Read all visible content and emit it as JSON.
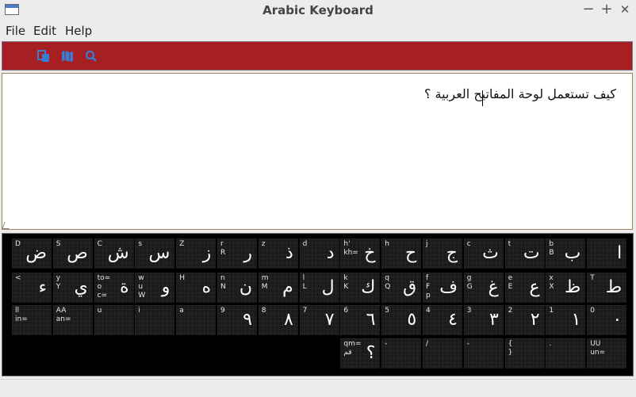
{
  "window": {
    "title": "Arabic Keyboard",
    "minimize": "−",
    "maximize": "+",
    "close": "✕"
  },
  "menu": [
    "File",
    "Edit",
    "Help"
  ],
  "toolbar": {
    "buttons": [
      "copy-icon",
      "map-icon",
      "search-icon"
    ],
    "color": "#a61f22",
    "icon_color": "#3a7bd5"
  },
  "editor": {
    "text": "كيف تستعمل لوحة المفاتيح العربية ؟"
  },
  "keyboard": {
    "rows": [
      [
        {
          "lat": "D",
          "ar": "ض"
        },
        {
          "lat": "S",
          "ar": "ص"
        },
        {
          "lat": "C",
          "ar": "ش"
        },
        {
          "lat": "s",
          "ar": "س"
        },
        {
          "lat": "Z",
          "ar": "ز"
        },
        {
          "lat": "r\nR",
          "ar": "ر"
        },
        {
          "lat": "z",
          "ar": "ذ"
        },
        {
          "lat": "d",
          "ar": "د"
        },
        {
          "lat": "h'\nkh=",
          "ar": "خ"
        },
        {
          "lat": "h",
          "ar": "ح"
        },
        {
          "lat": "j",
          "ar": "ج"
        },
        {
          "lat": "c",
          "ar": "ث"
        },
        {
          "lat": "t",
          "ar": "ت"
        },
        {
          "lat": "b\nB",
          "ar": "ب"
        },
        {
          "lat": "",
          "ar": "ا"
        }
      ],
      [
        {
          "lat": "<",
          "ar": "ء"
        },
        {
          "lat": "y\nY",
          "ar": "ي"
        },
        {
          "lat": "to=\no\nc=",
          "ar": "ة"
        },
        {
          "lat": "w\nu\nW",
          "ar": "و"
        },
        {
          "lat": "H",
          "ar": "ه"
        },
        {
          "lat": "n\nN",
          "ar": "ن"
        },
        {
          "lat": "m\nM",
          "ar": "م"
        },
        {
          "lat": "l\nL",
          "ar": "ل"
        },
        {
          "lat": "k\nK",
          "ar": "ك"
        },
        {
          "lat": "q\nQ",
          "ar": "ق"
        },
        {
          "lat": "f\nF\np",
          "ar": "ف"
        },
        {
          "lat": "g\nG",
          "ar": "غ"
        },
        {
          "lat": "e\nE",
          "ar": "ع"
        },
        {
          "lat": "x\nX",
          "ar": "ظ"
        },
        {
          "lat": "T",
          "ar": "ط"
        }
      ],
      [
        {
          "lat": "ll\nin=",
          "ar": ""
        },
        {
          "lat": "AA\nan=",
          "ar": ""
        },
        {
          "lat": "u",
          "ar": ""
        },
        {
          "lat": "i",
          "ar": ""
        },
        {
          "lat": "a",
          "ar": ""
        },
        {
          "lat": "9",
          "ar": "٩"
        },
        {
          "lat": "8",
          "ar": "٨"
        },
        {
          "lat": "7",
          "ar": "٧"
        },
        {
          "lat": "6",
          "ar": "٦"
        },
        {
          "lat": "5",
          "ar": "٥"
        },
        {
          "lat": "4",
          "ar": "٤"
        },
        {
          "lat": "3",
          "ar": "٣"
        },
        {
          "lat": "2",
          "ar": "٢"
        },
        {
          "lat": "1",
          "ar": "١"
        },
        {
          "lat": "0",
          "ar": "٠"
        }
      ],
      [
        {
          "lat": "qm=\nقم",
          "ar": "؟"
        },
        {
          "lat": "-",
          "ar": ""
        },
        {
          "lat": "/",
          "ar": ""
        },
        {
          "lat": "-",
          "ar": ""
        },
        {
          "lat": "{\n}",
          "ar": ""
        },
        {
          "lat": ".",
          "ar": ""
        },
        {
          "lat": "UU\nun=",
          "ar": ""
        }
      ]
    ]
  }
}
